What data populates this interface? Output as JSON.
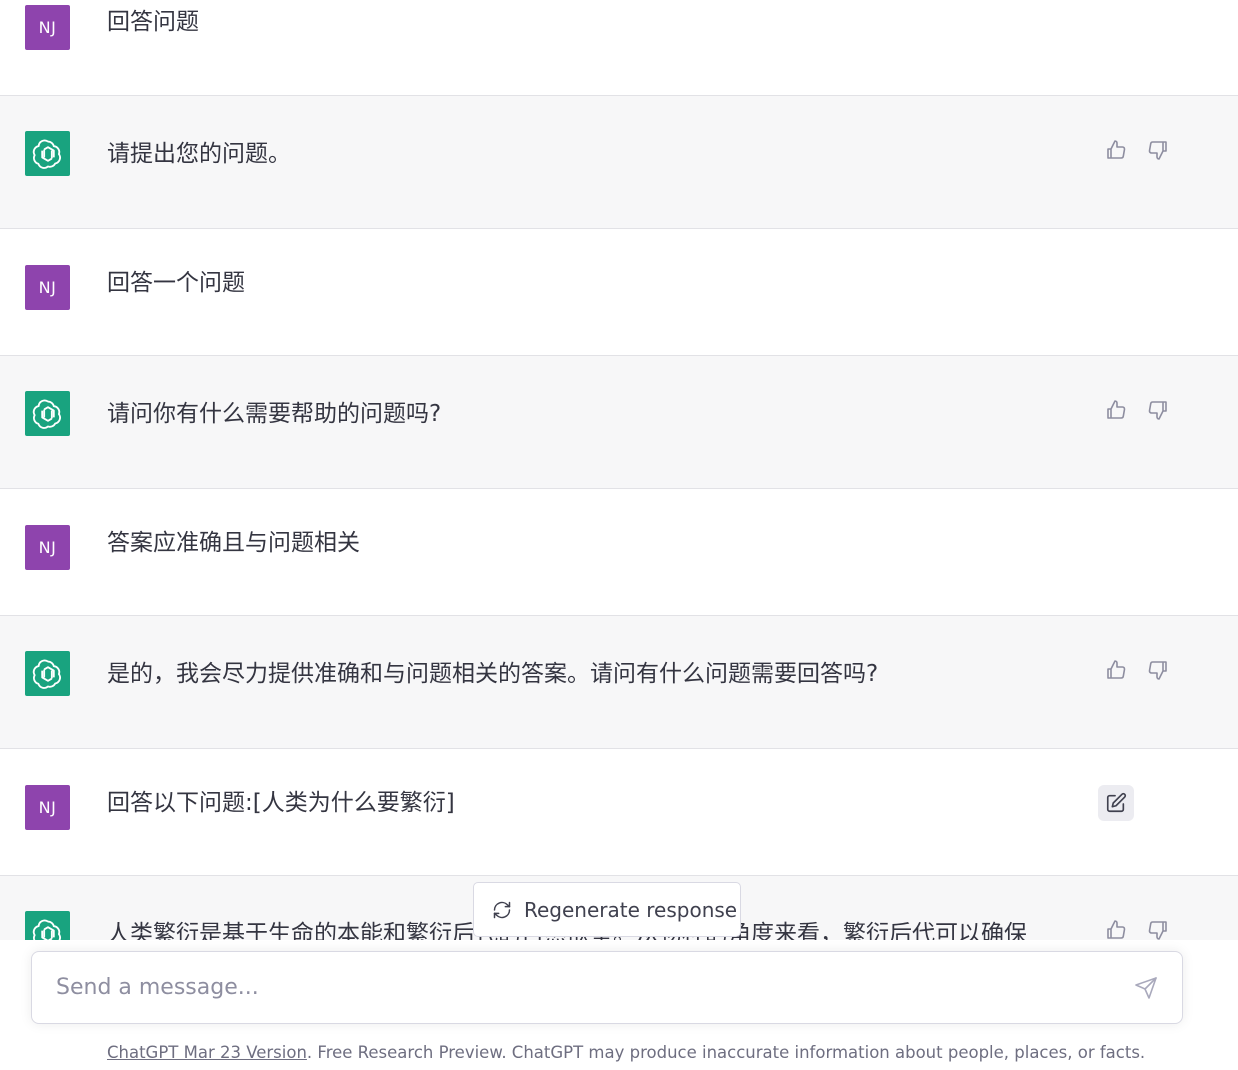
{
  "messages": [
    {
      "role": "user",
      "avatar": "NJ",
      "text": "回答问题"
    },
    {
      "role": "assistant",
      "text": "请提出您的问题。"
    },
    {
      "role": "user",
      "avatar": "NJ",
      "text": "回答一个问题"
    },
    {
      "role": "assistant",
      "text": "请问你有什么需要帮助的问题吗?"
    },
    {
      "role": "user",
      "avatar": "NJ",
      "text": "答案应准确且与问题相关"
    },
    {
      "role": "assistant",
      "text": "是的，我会尽力提供准确和与问题相关的答案。请问有什么问题需要回答吗?"
    },
    {
      "role": "user",
      "avatar": "NJ",
      "text": "回答以下问题:[人类为什么要繁衍]"
    },
    {
      "role": "assistant",
      "text": "人类繁衍是基于生命的本能和繁衍后代的自然欲望。从物种的角度来看，繁衍后代可以确保"
    }
  ],
  "regenerate": {
    "label": "Regenerate response"
  },
  "composer": {
    "placeholder": "Send a message..."
  },
  "footer": {
    "link": "ChatGPT Mar 23 Version",
    "text": ". Free Research Preview. ChatGPT may produce inaccurate information about people, places, or facts."
  },
  "colors": {
    "user_avatar": "#8e44ad",
    "assistant_avatar": "#19a37f",
    "assistant_row_bg": "#f7f7f8"
  },
  "icons": {
    "assistant_avatar": "openai-logo-icon",
    "like": "thumbs-up-icon",
    "dislike": "thumbs-down-icon",
    "edit": "edit-icon",
    "regenerate": "refresh-icon",
    "send": "send-icon"
  }
}
